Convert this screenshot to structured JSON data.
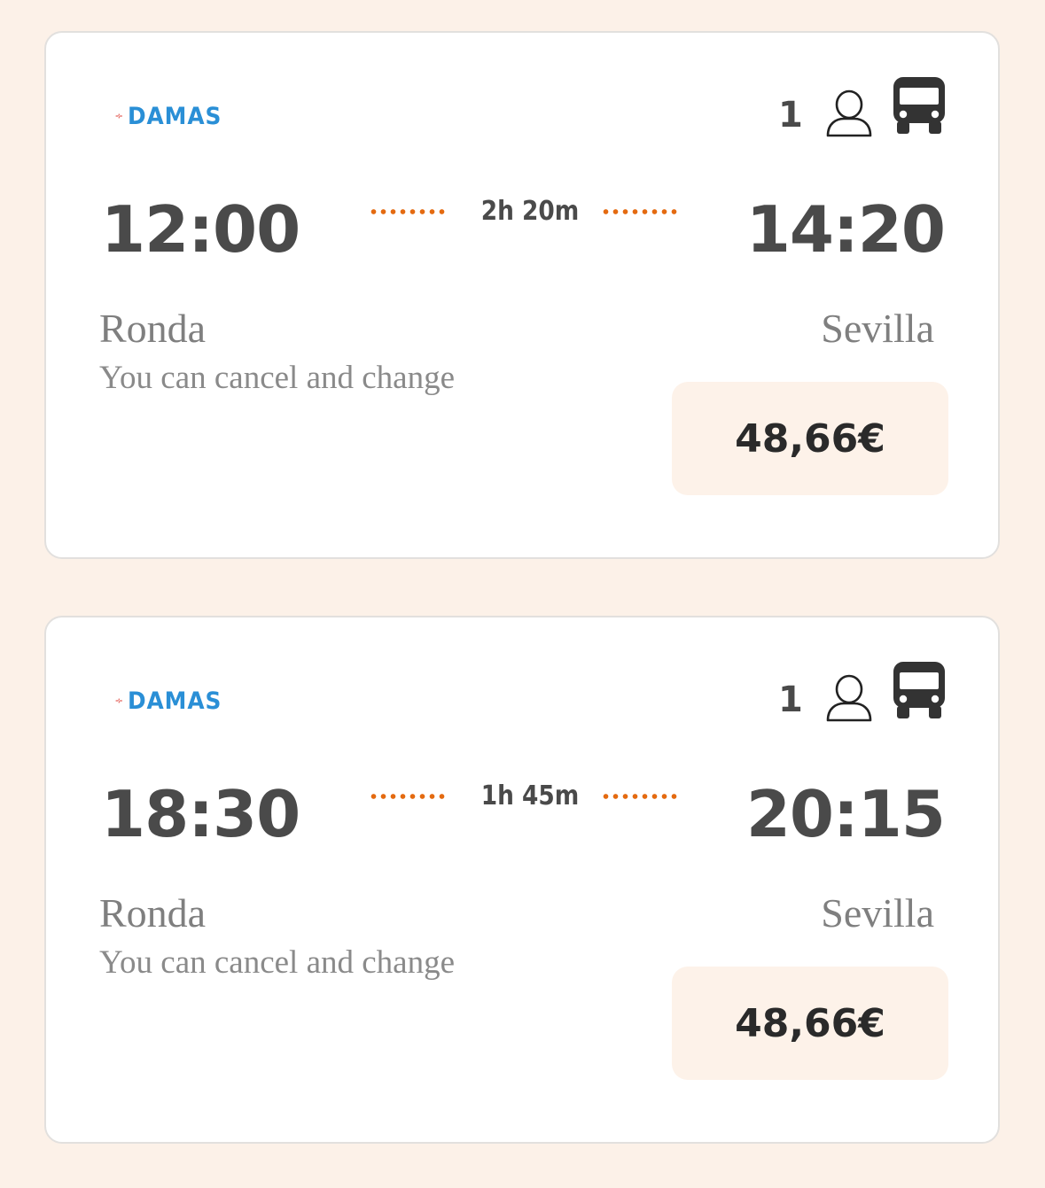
{
  "trips": [
    {
      "operator": "DAMAS",
      "passengers": "1",
      "departure_time": "12:00",
      "arrival_time": "14:20",
      "duration": "2h 20m",
      "origin": "Ronda",
      "destination": "Sevilla",
      "cancellation_note": "You can cancel and change",
      "price": "48,66€"
    },
    {
      "operator": "DAMAS",
      "passengers": "1",
      "departure_time": "18:30",
      "arrival_time": "20:15",
      "duration": "1h 45m",
      "origin": "Ronda",
      "destination": "Sevilla",
      "cancellation_note": "You can cancel and change",
      "price": "48,66€"
    }
  ],
  "icons": {
    "passenger": "person-outline-icon",
    "vehicle": "bus-icon"
  },
  "colors": {
    "background": "#fcf1e8",
    "card": "#ffffff",
    "accent_dots": "#e46a10",
    "price_button": "#fdf2e9",
    "logo_blue": "#2a8fd6",
    "logo_red": "#d9261c"
  }
}
